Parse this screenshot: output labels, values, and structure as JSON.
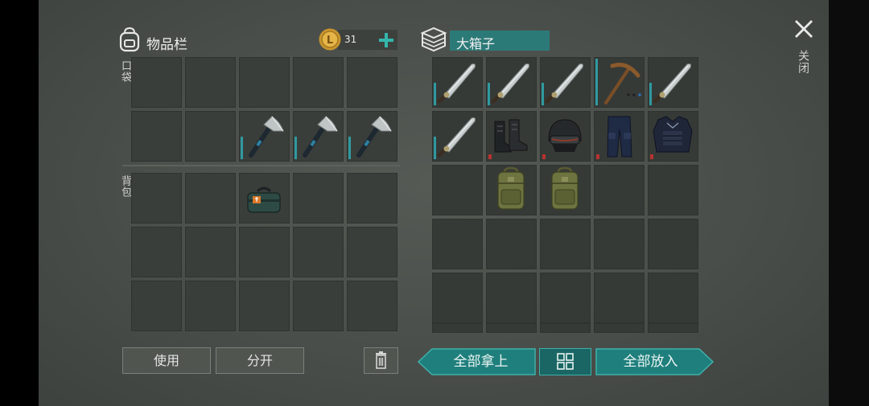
{
  "inventory": {
    "title": "物品栏",
    "coins": "31",
    "section_pocket": "口袋",
    "section_backpack": "背包",
    "use_label": "使用",
    "split_label": "分开"
  },
  "chest": {
    "title": "大箱子",
    "take_all_label": "全部拿上",
    "put_all_label": "全部放入"
  },
  "close_label": "关闭",
  "icons": {
    "backpack": "backpack-icon",
    "coin": "coin-icon",
    "add": "plus-icon",
    "chest": "chest-icon",
    "close": "close-icon",
    "trash": "trash-icon",
    "sort": "sort-grid-icon"
  },
  "items": {
    "pocket": [
      "",
      "",
      "",
      "",
      "",
      "",
      "",
      "hatchet",
      "hatchet",
      "hatchet"
    ],
    "backpack": [
      "",
      "",
      "toolbox",
      "",
      "",
      "",
      "",
      "",
      "",
      "",
      "",
      "",
      "",
      "",
      ""
    ],
    "chest": [
      "machete",
      "machete",
      "machete",
      "pickaxe",
      "machete",
      "machete",
      "boots",
      "helmet",
      "pants",
      "vest",
      "",
      "backpack",
      "backpack",
      "",
      ""
    ]
  },
  "colors": {
    "accent": "#1f7f7c",
    "durability": "#2f9aa0",
    "damage": "#b8322f"
  }
}
